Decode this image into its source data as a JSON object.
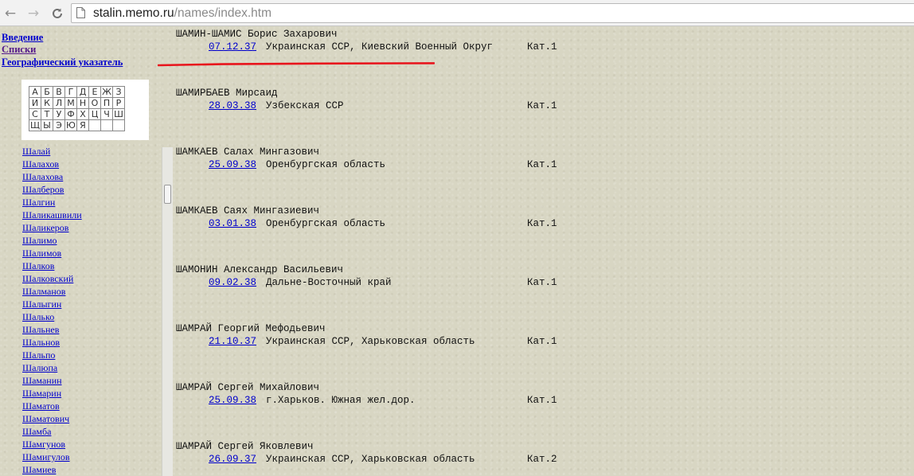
{
  "browser": {
    "url_host": "stalin.memo.ru",
    "url_path": "/names/index.htm",
    "back_icon": "back-arrow-icon",
    "forward_icon": "forward-arrow-icon",
    "reload_icon": "reload-icon"
  },
  "nav": {
    "intro": "Введение",
    "lists": "Списки",
    "geo": "Географический указатель"
  },
  "alphabet": [
    [
      "А",
      "Б",
      "В",
      "Г",
      "Д",
      "Е",
      "Ж",
      "З"
    ],
    [
      "И",
      "К",
      "Л",
      "М",
      "Н",
      "О",
      "П",
      "Р"
    ],
    [
      "С",
      "Т",
      "У",
      "Ф",
      "Х",
      "Ц",
      "Ч",
      "Ш"
    ],
    [
      "Щ",
      "Ы",
      "Э",
      "Ю",
      "Я",
      "",
      "",
      ""
    ]
  ],
  "names": [
    "Шалай",
    "Шалахов",
    "Шалахова",
    "Шалберов",
    "Шалгин",
    "Шаликашвили",
    "Шаликеров",
    "Шалимо",
    "Шалимов",
    "Шалков",
    "Шалковский",
    "Шалманов",
    "Шалыгин",
    "Шалько",
    "Шальнев",
    "Шальнов",
    "Шальпо",
    "Шалюпа",
    "Шаманин",
    "Шамарин",
    "Шаматов",
    "Шаматович",
    "Шамба",
    "Шамгунов",
    "Шамигулов",
    "Шамиев"
  ],
  "records": [
    {
      "name": "ШАМИН-ШАМИС Борис Захарович",
      "date": "07.12.37",
      "place": "Украинская ССР, Киевский Военный Округ",
      "cat": "Кат.1"
    },
    {
      "name": "ШАМИРБАЕВ Мирсаид",
      "date": "28.03.38",
      "place": "Узбекская ССР",
      "cat": "Кат.1"
    },
    {
      "name": "ШАМКАЕВ Салах Мингазович",
      "date": "25.09.38",
      "place": "Оренбургская область",
      "cat": "Кат.1"
    },
    {
      "name": "ШАМКАЕВ Саях Мингазиевич",
      "date": "03.01.38",
      "place": "Оренбургская область",
      "cat": "Кат.1"
    },
    {
      "name": "ШАМОНИН Александр Васильевич",
      "date": "09.02.38",
      "place": "Дальне-Восточный край",
      "cat": "Кат.1"
    },
    {
      "name": "ШАМРАЙ Георгий Мефодьевич",
      "date": "21.10.37",
      "place": "Украинская ССР, Харьковская область",
      "cat": "Кат.1"
    },
    {
      "name": "ШАМРАЙ Сергей Михайлович",
      "date": "25.09.38",
      "place": "г.Харьков. Южная жел.дор.",
      "cat": "Кат.1"
    },
    {
      "name": "ШАМРАЙ Сергей Яковлевич",
      "date": "26.09.37",
      "place": "Украинская ССР, Харьковская область",
      "cat": "Кат.2"
    }
  ],
  "colors": {
    "link": "#0000cc",
    "visited": "#551a8b",
    "highlight": "#e8141c",
    "background": "#d8d6c3"
  }
}
